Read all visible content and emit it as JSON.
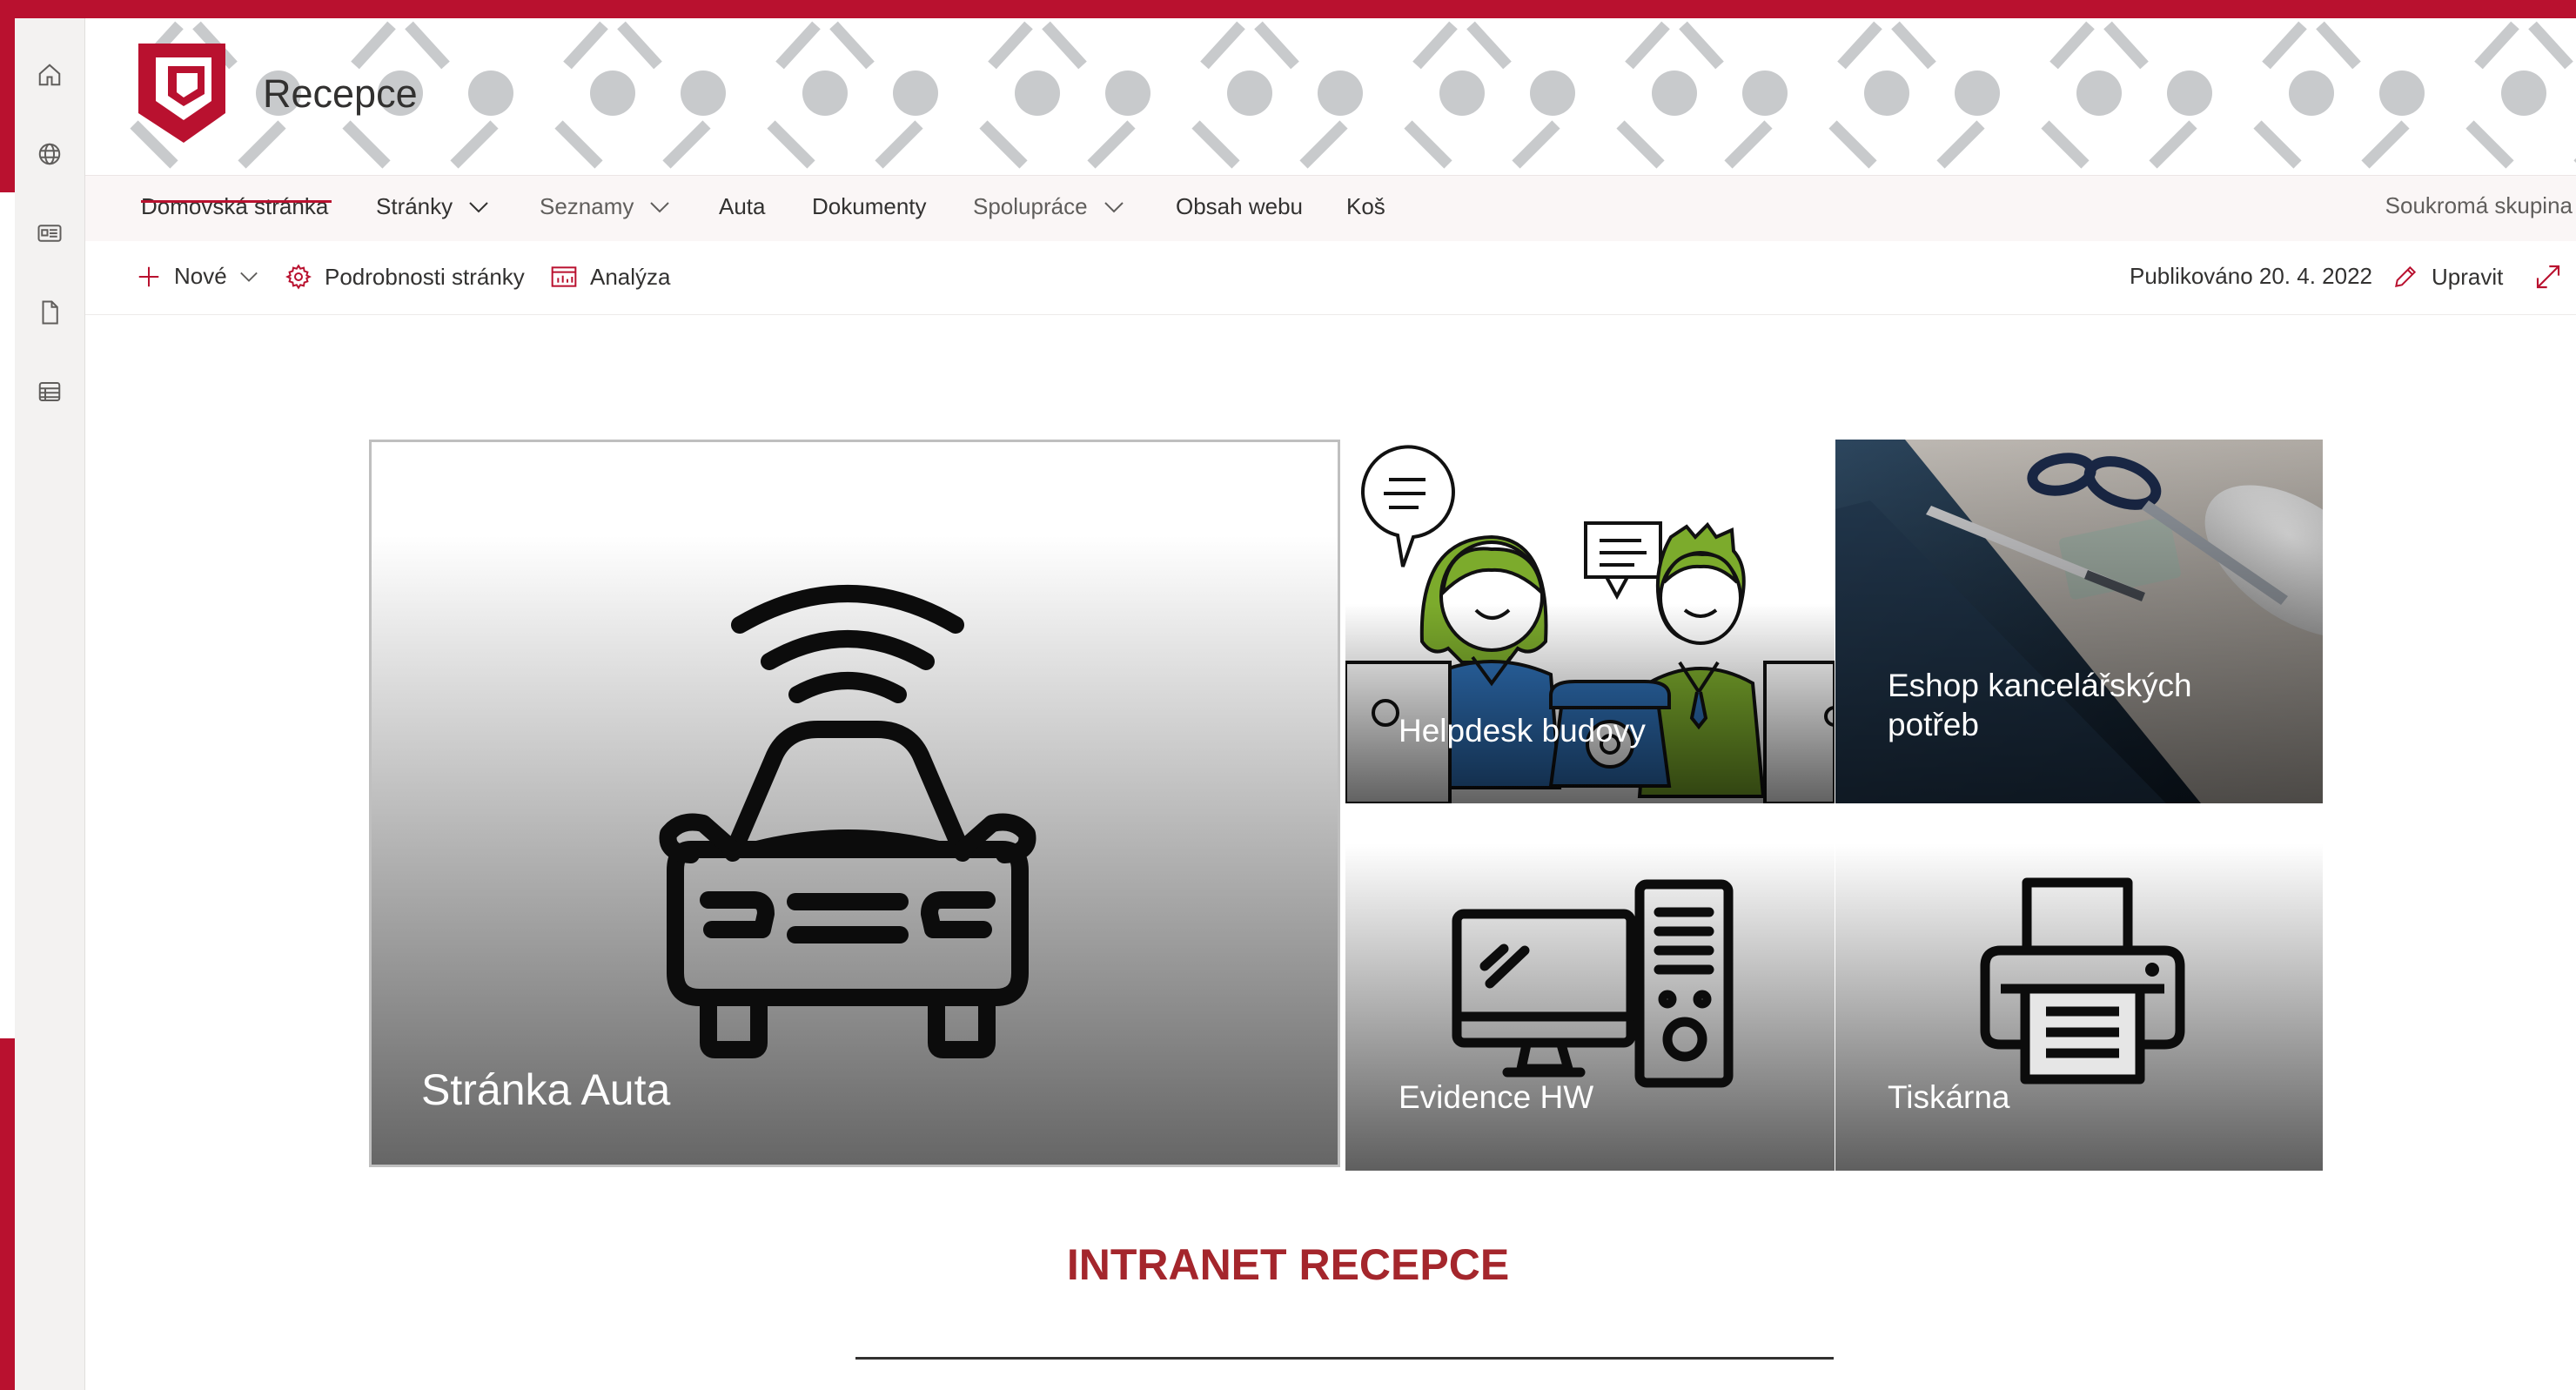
{
  "site": {
    "title": "Recepce"
  },
  "app_bar": {
    "items": [
      {
        "icon": "home-icon"
      },
      {
        "icon": "globe-icon"
      },
      {
        "icon": "news-icon"
      },
      {
        "icon": "document-icon"
      },
      {
        "icon": "list-icon"
      }
    ]
  },
  "nav": {
    "items": [
      {
        "label": "Domovská stránka",
        "active": true
      },
      {
        "label": "Stránky",
        "has_dropdown": true
      },
      {
        "label": "Seznamy",
        "has_dropdown": true
      },
      {
        "label": "Auta"
      },
      {
        "label": "Dokumenty"
      },
      {
        "label": "Spolupráce",
        "has_dropdown": true
      },
      {
        "label": "Obsah webu"
      },
      {
        "label": "Koš"
      }
    ],
    "privacy": "Soukromá skupina"
  },
  "command_bar": {
    "new_label": "Nové",
    "page_details_label": "Podrobnosti stránky",
    "analytics_label": "Analýza",
    "published_label": "Publikováno 20. 4. 2022",
    "edit_label": "Upravit"
  },
  "hero": {
    "tiles": [
      {
        "title": "Stránka Auta",
        "icon": "connected-car-icon"
      },
      {
        "title": "Helpdesk budovy",
        "icon": "helpdesk-illustration"
      },
      {
        "title": "Eshop kancelářských potřeb",
        "icon": "office-supplies-photo"
      },
      {
        "title": "Evidence HW",
        "icon": "desktop-computer-icon"
      },
      {
        "title": "Tiskárna",
        "icon": "printer-icon"
      }
    ]
  },
  "intro": {
    "heading": "INTRANET RECEPCE"
  },
  "colors": {
    "brand": "#b9112f",
    "heading": "#a4262c",
    "pattern": "#c8cacc"
  }
}
